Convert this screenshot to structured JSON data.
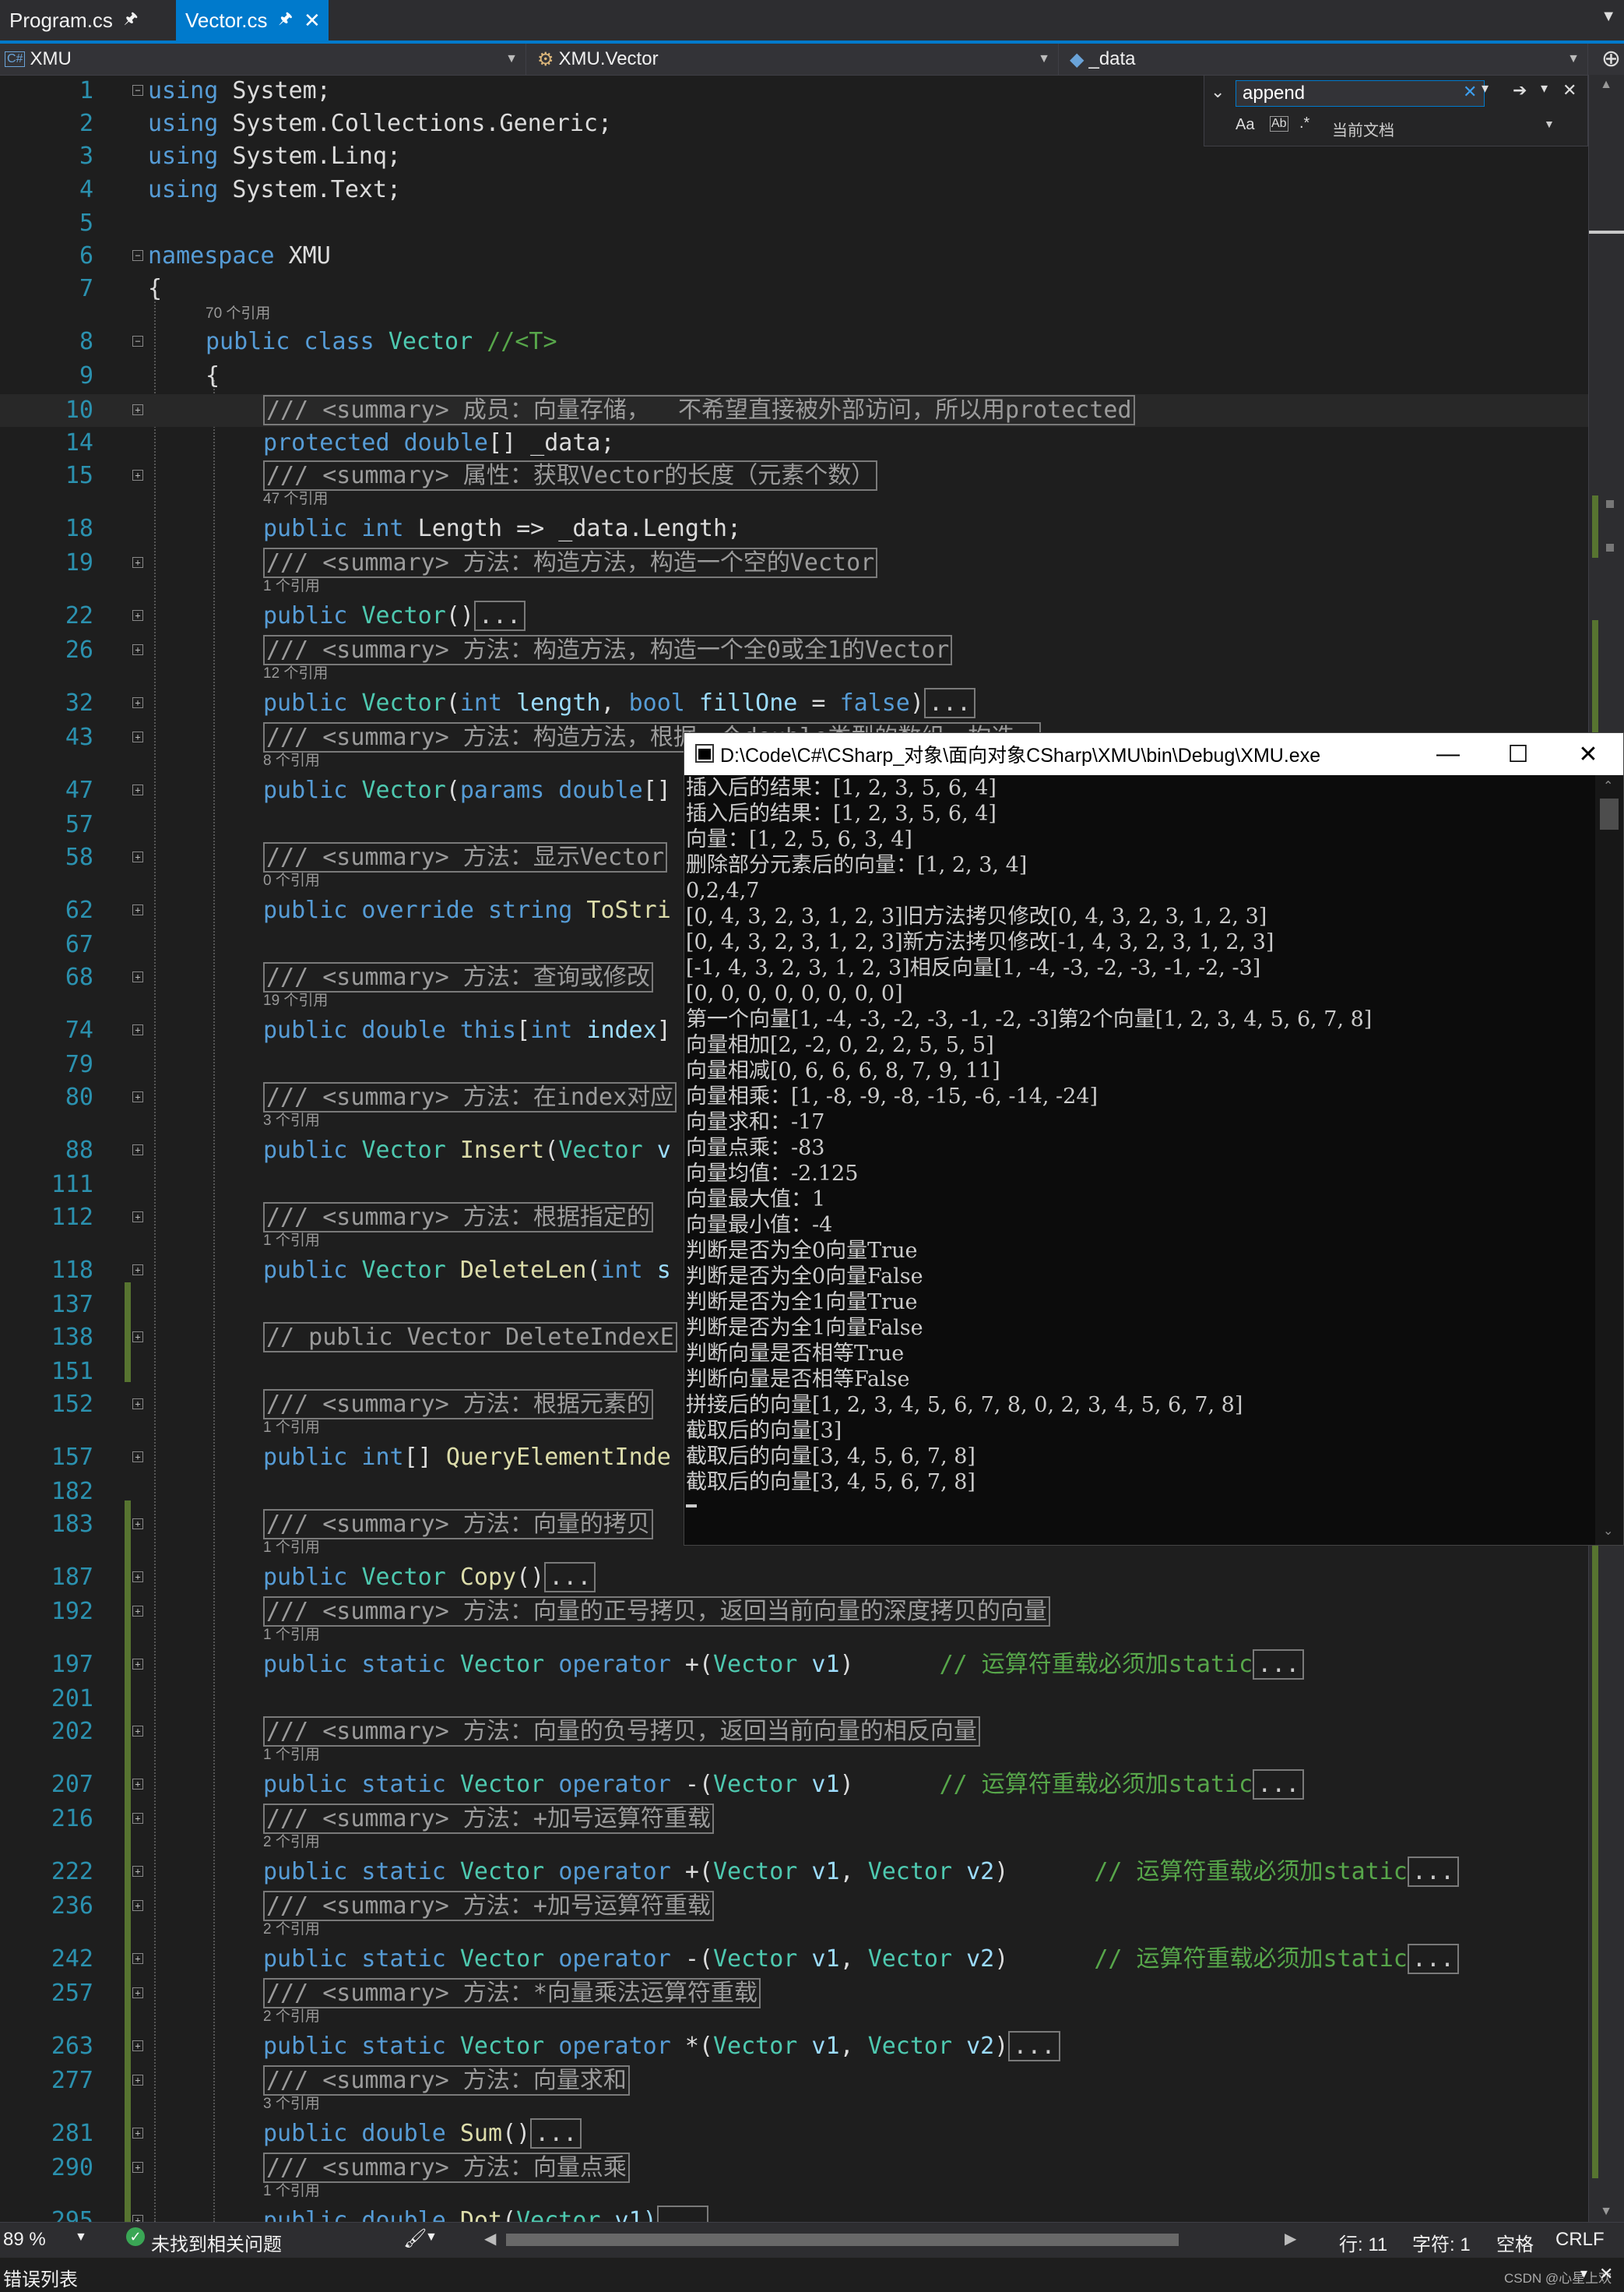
{
  "tabs": [
    {
      "label": "Program.cs",
      "active": false
    },
    {
      "label": "Vector.cs",
      "active": true
    }
  ],
  "nav": {
    "project_tag": "C#",
    "project": "XMU",
    "class": "XMU.Vector",
    "member": "_data"
  },
  "find": {
    "query": "append",
    "scope": "当前文档",
    "option_case": "Aa",
    "option_word": "Ab"
  },
  "refs": {
    "r70": "70 个引用",
    "r47": "47 个引用",
    "r1": "1 个引用",
    "r12": "12 个引用",
    "r8": "8 个引用",
    "r0": "0 个引用",
    "r19": "19 个引用",
    "r3": "3 个引用",
    "r2": "2 个引用"
  },
  "code": {
    "l1_kw": "using",
    "l1_rest": " System;",
    "l2_kw": "using",
    "l2_rest": " System.Collections.Generic;",
    "l3_kw": "using",
    "l3_rest": " System.Linq;",
    "l4_kw": "using",
    "l4_rest": " System.Text;",
    "l6_kw": "namespace",
    "l6_rest": " XMU",
    "brace_open": "{",
    "l8_kw": "public class ",
    "l8_ty": "Vector",
    "l8_cm": " //<T>",
    "l10": "/// <summary> 成员：向量存储，  不希望直接被外部访问，所以用protected",
    "l14_kw": "protected double",
    "l14_rest": "[] _data;",
    "l15": "/// <summary> 属性：获取Vector的长度（元素个数）",
    "l18_kw": "public int",
    "l18_rest": " Length => _data.Length;",
    "l19": "/// <summary> 方法：构造方法，构造一个空的Vector",
    "l22_kw": "public ",
    "l22_ty": "Vector",
    "l22_rest": "()",
    "dots": "...",
    "l26": "/// <summary> 方法：构造方法，构造一个全0或全1的Vector",
    "l32_kw": "public ",
    "l32_ty": "Vector",
    "l32_a": "(",
    "l32_k2": "int",
    "l32_p1": " length",
    "l32_b": ", ",
    "l32_k3": "bool",
    "l32_p2": " fillOne",
    "l32_c": " = ",
    "l32_k4": "false",
    "l32_d": ")",
    "l43": "/// <summary> 方法：构造方法，根据一个double类型的数组，构造一",
    "l47_kw": "public ",
    "l47_ty": "Vector",
    "l47_a": "(",
    "l47_k2": "params double",
    "l47_b": "[]",
    "l58": "/// <summary> 方法：显示Vector",
    "l62_kw": "public override string ",
    "l62_fn": "ToStri",
    "l68": "/// <summary> 方法：查询或修改",
    "l74_kw": "public double this",
    "l74_a": "[",
    "l74_k2": "int",
    "l74_p": " index",
    "l74_b": "]",
    "l80": "/// <summary> 方法：在index对应",
    "l88_kw": "public ",
    "l88_ty": "Vector",
    "l88_sp": " ",
    "l88_fn": "Insert",
    "l88_a": "(",
    "l88_ty2": "Vector",
    "l88_p": " v",
    "l112": "/// <summary> 方法：根据指定的",
    "l118_kw": "public ",
    "l118_ty": "Vector",
    "l118_sp": " ",
    "l118_fn": "DeleteLen",
    "l118_a": "(",
    "l118_k2": "int",
    "l118_p": " s",
    "l138": "// public Vector DeleteIndexE",
    "l152": "/// <summary> 方法：根据元素的",
    "l157_kw": "public int",
    "l157_a": "[] ",
    "l157_fn": "QueryElementInde",
    "l183": "/// <summary> 方法：向量的拷贝",
    "l187_kw": "public ",
    "l187_ty": "Vector",
    "l187_sp": " ",
    "l187_fn": "Copy",
    "l187_a": "()",
    "l192": "/// <summary> 方法：向量的正号拷贝，返回当前向量的深度拷贝的向量",
    "op_kw": "public static ",
    "op_ty": "Vector",
    "op_sp": " ",
    "op_kw2": "operator",
    "l197_op": " +(",
    "l197_ty": "Vector",
    "l197_p": " v1",
    "l197_b": ")",
    "cm_static": "// 运算符重载必须加static",
    "l202": "/// <summary> 方法：向量的负号拷贝，返回当前向量的相反向量",
    "l207_op": " -(",
    "l207_ty": "Vector",
    "l207_p": " v1",
    "l207_b": ")",
    "l216": "/// <summary> 方法：+加号运算符重载",
    "l222_op": " +(",
    "v1v2_ty1": "Vector",
    "v1v2_p1": " v1",
    "v1v2_c": ", ",
    "v1v2_ty2": "Vector",
    "v1v2_p2": " v2",
    "v1v2_b": ")",
    "l236": "/// <summary> 方法：+加号运算符重载",
    "l242_op": " -(",
    "l257": "/// <summary> 方法：*向量乘法运算符重载",
    "l263_op": " *(",
    "l277": "/// <summary> 方法：向量求和",
    "l281_kw": "public double ",
    "l281_fn": "Sum",
    "l281_a": "()",
    "l290": "/// <summary> 方法：向量点乘",
    "l295_kw": "public double ",
    "l295_fn": "Dot",
    "l295_a": "(",
    "l295_ty": "Vector",
    "l295_p": " v1)"
  },
  "console": {
    "title": "D:\\Code\\C#\\CSharp_对象\\面向对象CSharp\\XMU\\bin\\Debug\\XMU.exe",
    "lines": [
      "插入后的结果：[1, 2, 3, 5, 6, 4]",
      "插入后的结果：[1, 2, 3, 5, 6, 4]",
      "向量：[1, 2, 5, 6, 3, 4]",
      "删除部分元素后的向量：[1, 2, 3, 4]",
      "0,2,4,7",
      "[0, 4, 3, 2, 3, 1, 2, 3]旧方法拷贝修改[0, 4, 3, 2, 3, 1, 2, 3]",
      "[0, 4, 3, 2, 3, 1, 2, 3]新方法拷贝修改[-1, 4, 3, 2, 3, 1, 2, 3]",
      "[-1, 4, 3, 2, 3, 1, 2, 3]相反向量[1, -4, -3, -2, -3, -1, -2, -3]",
      "[0, 0, 0, 0, 0, 0, 0, 0]",
      "第一个向量[1, -4, -3, -2, -3, -1, -2, -3]第2个向量[1, 2, 3, 4, 5, 6, 7, 8]",
      "向量相加[2, -2, 0, 2, 2, 5, 5, 5]",
      "向量相减[0, 6, 6, 6, 8, 7, 9, 11]",
      "向量相乘：[1, -8, -9, -8, -15, -6, -14, -24]",
      "向量求和：-17",
      "向量点乘：-83",
      "向量均值：-2.125",
      "向量最大值：1",
      "向量最小值：-4",
      "判断是否为全0向量True",
      "判断是否为全0向量False",
      "判断是否为全1向量True",
      "判断是否为全1向量False",
      "判断向量是否相等True",
      "判断向量是否相等False",
      "拼接后的向量[1, 2, 3, 4, 5, 6, 7, 8, 0, 2, 3, 4, 5, 6, 7, 8]",
      "截取后的向量[3]",
      "截取后的向量[3, 4, 5, 6, 7, 8]",
      "截取后的向量[3, 4, 5, 6, 7, 8]"
    ]
  },
  "status": {
    "zoom": "89 %",
    "issues": "未找到相关问题",
    "row": "行: 11",
    "col": "字符: 1",
    "indent": "空格",
    "eol": "CRLF"
  },
  "bottom": {
    "error_list": "错误列表",
    "watermark": "CSDN @心星上欢"
  }
}
